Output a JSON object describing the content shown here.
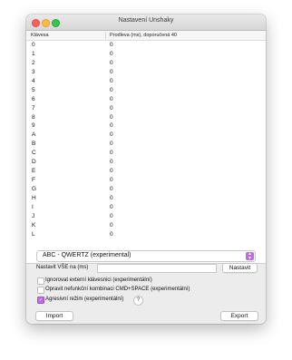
{
  "window": {
    "title": "Nastavení Unshaky"
  },
  "table": {
    "headers": [
      "Klávesa",
      "Prodleva (ms), doporučená 40"
    ],
    "rows": [
      [
        "0",
        "0"
      ],
      [
        "1",
        "0"
      ],
      [
        "2",
        "0"
      ],
      [
        "3",
        "0"
      ],
      [
        "4",
        "0"
      ],
      [
        "5",
        "0"
      ],
      [
        "6",
        "0"
      ],
      [
        "7",
        "0"
      ],
      [
        "8",
        "0"
      ],
      [
        "9",
        "0"
      ],
      [
        "A",
        "0"
      ],
      [
        "B",
        "0"
      ],
      [
        "C",
        "0"
      ],
      [
        "D",
        "0"
      ],
      [
        "E",
        "0"
      ],
      [
        "F",
        "0"
      ],
      [
        "G",
        "0"
      ],
      [
        "H",
        "0"
      ],
      [
        "I",
        "0"
      ],
      [
        "J",
        "0"
      ],
      [
        "K",
        "0"
      ],
      [
        "L",
        "0"
      ]
    ]
  },
  "layout_select": {
    "value": "ABC - QWERTZ (experimental)",
    "accent": "#b86ee0"
  },
  "set_all": {
    "label": "Nastavit VŠE na (ms)",
    "value": "",
    "button": "Nastavit"
  },
  "options": [
    {
      "label": "Ignorovat externí klávesnici (experimentální)",
      "checked": false
    },
    {
      "label": "Opravit nefunkční kombinaci CMD+SPACE (experimentální)",
      "checked": false
    },
    {
      "label": "Agresivní režim (experimentální)",
      "checked": true
    }
  ],
  "help_label": "?",
  "footer": {
    "import": "Import",
    "export": "Export"
  }
}
